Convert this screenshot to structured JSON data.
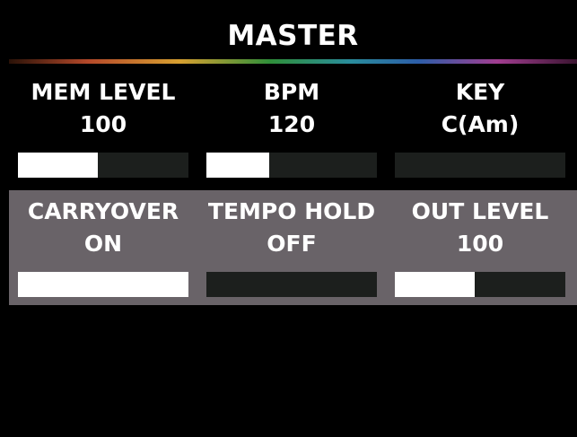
{
  "header": {
    "title": "MASTER"
  },
  "colors": {
    "background": "#000000",
    "selected_row_background": "#696368",
    "bar_track": "#1c1f1d",
    "bar_fill": "#ffffff",
    "text": "#ffffff"
  },
  "params": [
    {
      "label": "MEM LEVEL",
      "value": "100",
      "level": 0.47
    },
    {
      "label": "BPM",
      "value": "120",
      "level": 0.37
    },
    {
      "label": "KEY",
      "value": "C(Am)",
      "level": 0
    },
    {
      "label": "CARRYOVER",
      "value": "ON",
      "level": 1.0
    },
    {
      "label": "TEMPO HOLD",
      "value": "OFF",
      "level": 0
    },
    {
      "label": "OUT LEVEL",
      "value": "100",
      "level": 0.47
    }
  ],
  "selected_row": 2
}
